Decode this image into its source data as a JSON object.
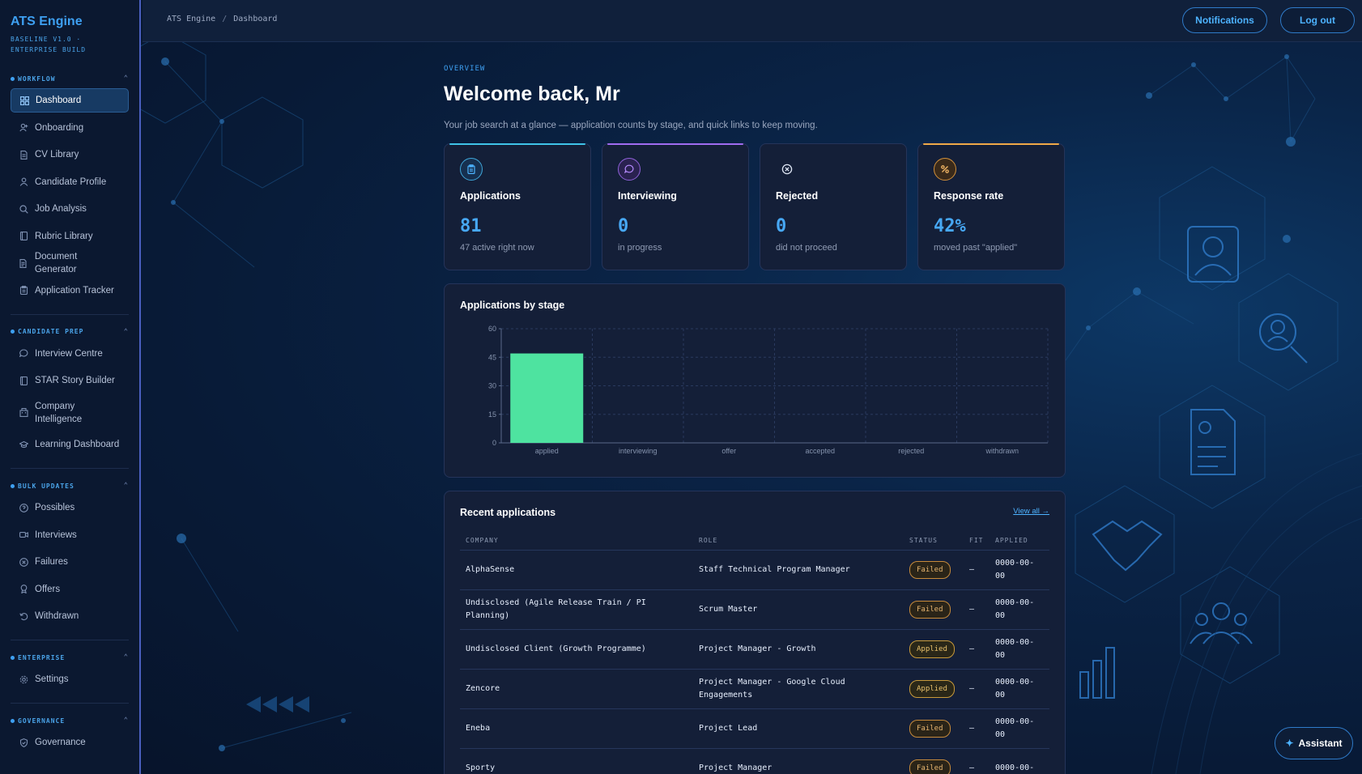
{
  "app": {
    "title": "ATS Engine",
    "subtitle": "BASELINE V1.0 · ENTERPRISE BUILD"
  },
  "breadcrumb": {
    "root": "ATS Engine",
    "separator": "/",
    "current": "Dashboard"
  },
  "header_actions": {
    "notifications": "Notifications",
    "logout": "Log out"
  },
  "sidebar": {
    "workflow": {
      "label": "WORKFLOW",
      "items": [
        {
          "label": "Dashboard",
          "icon": "grid-icon"
        },
        {
          "label": "Onboarding",
          "icon": "user-plus-icon"
        },
        {
          "label": "CV Library",
          "icon": "file-icon"
        },
        {
          "label": "Candidate Profile",
          "icon": "user-icon"
        },
        {
          "label": "Job Analysis",
          "icon": "search-icon"
        },
        {
          "label": "Rubric Library",
          "icon": "book-icon"
        },
        {
          "label": "Document Generator",
          "icon": "file-text-icon"
        },
        {
          "label": "Application Tracker",
          "icon": "clipboard-icon"
        }
      ]
    },
    "candidate_prep": {
      "label": "CANDIDATE PREP",
      "items": [
        {
          "label": "Interview Centre",
          "icon": "chat-icon"
        },
        {
          "label": "STAR Story Builder",
          "icon": "book-icon"
        },
        {
          "label": "Company Intelligence",
          "icon": "building-icon"
        },
        {
          "label": "Learning Dashboard",
          "icon": "graduation-cap-icon"
        }
      ]
    },
    "bulk_updates": {
      "label": "BULK UPDATES",
      "items": [
        {
          "label": "Possibles",
          "icon": "help-circle-icon"
        },
        {
          "label": "Interviews",
          "icon": "video-icon"
        },
        {
          "label": "Failures",
          "icon": "x-circle-icon"
        },
        {
          "label": "Offers",
          "icon": "award-icon"
        },
        {
          "label": "Withdrawn",
          "icon": "undo-icon"
        }
      ]
    },
    "enterprise": {
      "label": "ENTERPRISE",
      "items": [
        {
          "label": "Settings",
          "icon": "gear-icon"
        }
      ]
    },
    "governance": {
      "label": "GOVERNANCE",
      "items": [
        {
          "label": "Governance",
          "icon": "shield-icon"
        }
      ]
    }
  },
  "overview": {
    "overline": "OVERVIEW",
    "welcome": "Welcome back, Mr",
    "subtitle": "Your job search at a glance — application counts by stage, and quick links to keep moving."
  },
  "stats": [
    {
      "title": "Applications",
      "value": "81",
      "note": "47 active right now",
      "icon": "clipboard-icon",
      "accent": "#3fc3e8"
    },
    {
      "title": "Interviewing",
      "value": "0",
      "note": "in progress",
      "icon": "chat-icon",
      "accent": "#a06bf0"
    },
    {
      "title": "Rejected",
      "value": "0",
      "note": "did not proceed",
      "icon": "x-circle-icon",
      "accent": "#141f38"
    },
    {
      "title": "Response rate",
      "value": "42%",
      "note": "moved past \"applied\"",
      "icon": "percent-icon",
      "accent": "#f0a948"
    }
  ],
  "chart_panel": {
    "title": "Applications by stage"
  },
  "chart_data": {
    "type": "bar",
    "title": "Applications by stage",
    "categories": [
      "applied",
      "interviewing",
      "offer",
      "accepted",
      "rejected",
      "withdrawn"
    ],
    "values": [
      47,
      0,
      0,
      0,
      0,
      0
    ],
    "ylim": [
      0,
      60
    ],
    "yticks": [
      0,
      15,
      30,
      45,
      60
    ],
    "grid": true,
    "color": "#4ee3a0"
  },
  "recent": {
    "title": "Recent applications",
    "view_all": "View all →",
    "columns": [
      "COMPANY",
      "ROLE",
      "STATUS",
      "FIT",
      "APPLIED"
    ],
    "rows": [
      {
        "company": "AlphaSense",
        "role": "Staff Technical Program Manager",
        "status": "Failed",
        "fit": "—",
        "applied": "0000-00-00"
      },
      {
        "company": "Undisclosed (Agile Release Train / PI Planning)",
        "role": "Scrum Master",
        "status": "Failed",
        "fit": "—",
        "applied": "0000-00-00"
      },
      {
        "company": "Undisclosed Client (Growth Programme)",
        "role": "Project Manager - Growth",
        "status": "Applied",
        "fit": "—",
        "applied": "0000-00-00"
      },
      {
        "company": "Zencore",
        "role": "Project Manager - Google Cloud Engagements",
        "status": "Applied",
        "fit": "—",
        "applied": "0000-00-00"
      },
      {
        "company": "Eneba",
        "role": "Project Lead",
        "status": "Failed",
        "fit": "—",
        "applied": "0000-00-00"
      },
      {
        "company": "Sporty",
        "role": "Project Manager",
        "status": "Failed",
        "fit": "—",
        "applied": "0000-00-"
      }
    ]
  },
  "assistant": {
    "label": "Assistant"
  }
}
